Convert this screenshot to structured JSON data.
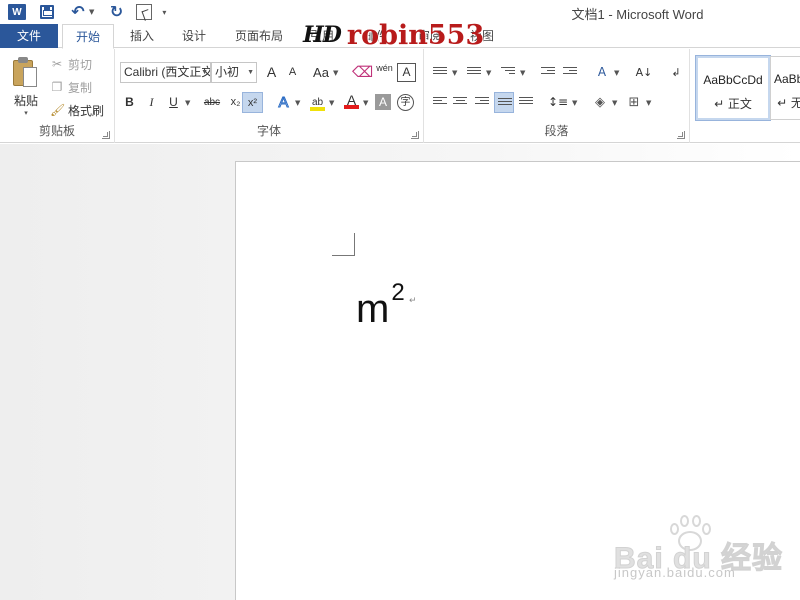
{
  "window": {
    "title": "文档1 - Microsoft Word"
  },
  "quick_access": {
    "app_icon": "word-icon",
    "app_icon_text": "W",
    "save": "save-icon",
    "undo": "undo-icon",
    "redo": "redo-icon",
    "touch_mode": "touch-mode-icon"
  },
  "tabs": [
    {
      "label": "文件"
    },
    {
      "label": "开始"
    },
    {
      "label": "插入"
    },
    {
      "label": "设计"
    },
    {
      "label": "页面布局"
    },
    {
      "label": "引用"
    },
    {
      "label": "邮件"
    },
    {
      "label": "审阅"
    },
    {
      "label": "视图"
    }
  ],
  "overlay_watermark": {
    "prefix": "HD",
    "name": "robin553"
  },
  "ribbon": {
    "clipboard": {
      "label": "剪贴板",
      "paste": "粘贴",
      "cut": "剪切",
      "copy": "复制",
      "format_painter": "格式刷"
    },
    "font": {
      "label": "字体",
      "font_name": "Calibri (西文正文)",
      "font_size": "小初",
      "grow": "A",
      "shrink": "A",
      "change_case": "Aa",
      "phonetic": "wén",
      "char_border": "A",
      "bold": "B",
      "italic": "I",
      "underline": "U",
      "strike": "abc",
      "subscript": "x₂",
      "superscript": "x²",
      "text_effects": "A",
      "font_color": "A",
      "char_shading": "A",
      "enclose": "字",
      "highlight_color": "#f0e10a",
      "font_color_value": "#e31b1b"
    },
    "paragraph": {
      "label": "段落"
    },
    "styles": {
      "items": [
        {
          "sample": "AaBbCcDd",
          "name": "↵ 正文"
        },
        {
          "sample": "AaBbl",
          "name": "↵ 无"
        }
      ]
    }
  },
  "document": {
    "base": "m",
    "superscript": "2",
    "para_mark": "↵"
  },
  "baidu_watermark": {
    "logo": "Bai du 经验",
    "url": "jingyan.baidu.com"
  }
}
